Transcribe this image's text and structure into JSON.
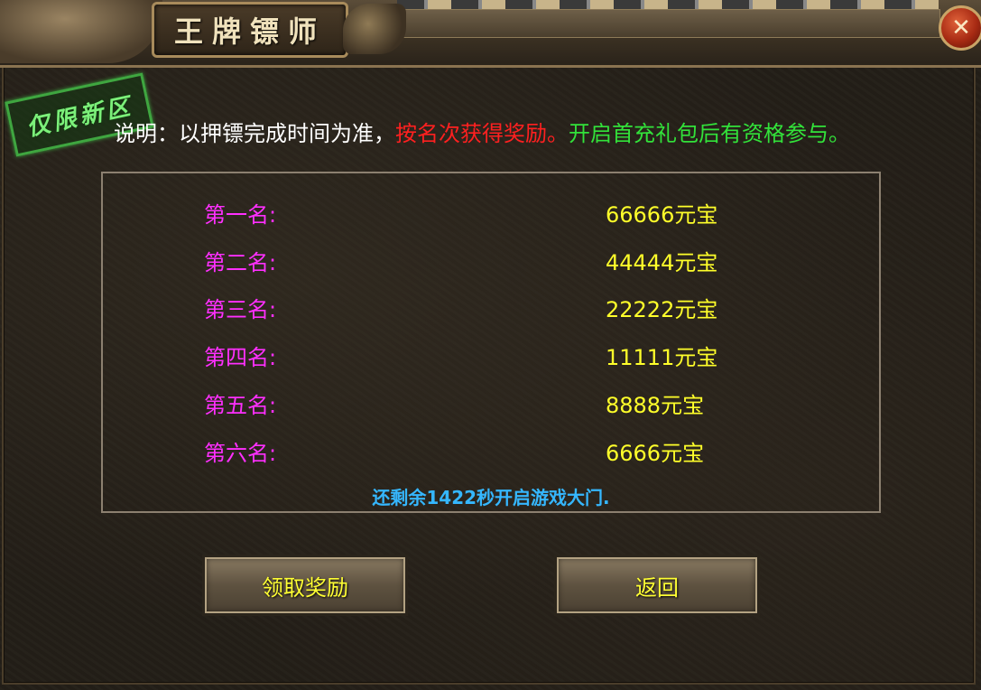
{
  "window": {
    "title": "王牌镖师",
    "close_icon": "✕"
  },
  "badge": {
    "text": "仅限新区"
  },
  "description": {
    "prefix": "说明：以押镖完成时间为准，",
    "highlight_red": "按名次获得奖励。",
    "highlight_green": "开启首充礼包后有资格参与。"
  },
  "rewards": [
    {
      "rank": "第一名:",
      "reward": "66666元宝"
    },
    {
      "rank": "第二名:",
      "reward": "44444元宝"
    },
    {
      "rank": "第三名:",
      "reward": "22222元宝"
    },
    {
      "rank": "第四名:",
      "reward": "11111元宝"
    },
    {
      "rank": "第五名:",
      "reward": "8888元宝"
    },
    {
      "rank": "第六名:",
      "reward": "6666元宝"
    }
  ],
  "countdown": "还剩余1422秒开启游戏大门.",
  "buttons": {
    "claim": "领取奖励",
    "back": "返回"
  },
  "colors": {
    "rank_label": "#ff2fff",
    "reward_value": "#ffff2a",
    "countdown": "#35b7ff",
    "warning": "#ff2020",
    "eligibility": "#32e23a"
  }
}
